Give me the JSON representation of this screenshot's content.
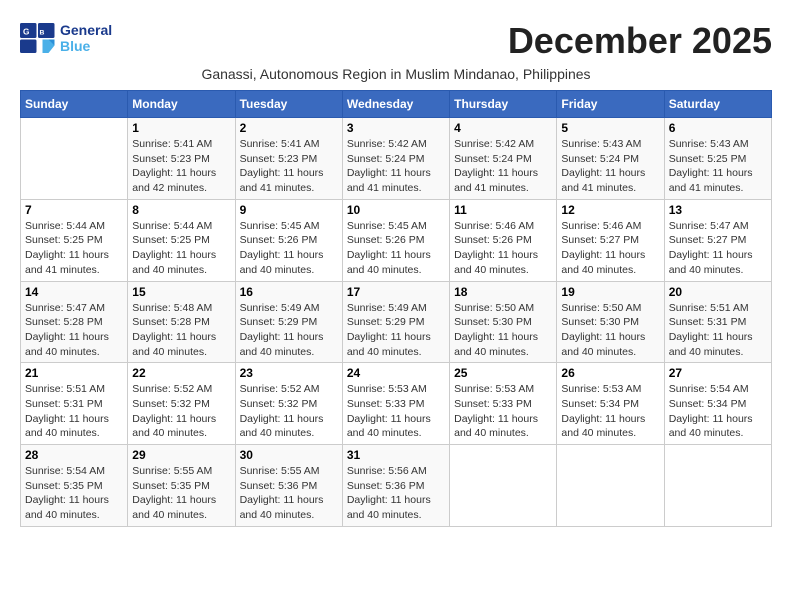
{
  "header": {
    "logo_line1": "General",
    "logo_line2": "Blue",
    "month_title": "December 2025",
    "subtitle": "Ganassi, Autonomous Region in Muslim Mindanao, Philippines"
  },
  "weekdays": [
    "Sunday",
    "Monday",
    "Tuesday",
    "Wednesday",
    "Thursday",
    "Friday",
    "Saturday"
  ],
  "weeks": [
    [
      {
        "day": "",
        "detail": ""
      },
      {
        "day": "1",
        "detail": "Sunrise: 5:41 AM\nSunset: 5:23 PM\nDaylight: 11 hours\nand 42 minutes."
      },
      {
        "day": "2",
        "detail": "Sunrise: 5:41 AM\nSunset: 5:23 PM\nDaylight: 11 hours\nand 41 minutes."
      },
      {
        "day": "3",
        "detail": "Sunrise: 5:42 AM\nSunset: 5:24 PM\nDaylight: 11 hours\nand 41 minutes."
      },
      {
        "day": "4",
        "detail": "Sunrise: 5:42 AM\nSunset: 5:24 PM\nDaylight: 11 hours\nand 41 minutes."
      },
      {
        "day": "5",
        "detail": "Sunrise: 5:43 AM\nSunset: 5:24 PM\nDaylight: 11 hours\nand 41 minutes."
      },
      {
        "day": "6",
        "detail": "Sunrise: 5:43 AM\nSunset: 5:25 PM\nDaylight: 11 hours\nand 41 minutes."
      }
    ],
    [
      {
        "day": "7",
        "detail": "Sunrise: 5:44 AM\nSunset: 5:25 PM\nDaylight: 11 hours\nand 41 minutes."
      },
      {
        "day": "8",
        "detail": "Sunrise: 5:44 AM\nSunset: 5:25 PM\nDaylight: 11 hours\nand 40 minutes."
      },
      {
        "day": "9",
        "detail": "Sunrise: 5:45 AM\nSunset: 5:26 PM\nDaylight: 11 hours\nand 40 minutes."
      },
      {
        "day": "10",
        "detail": "Sunrise: 5:45 AM\nSunset: 5:26 PM\nDaylight: 11 hours\nand 40 minutes."
      },
      {
        "day": "11",
        "detail": "Sunrise: 5:46 AM\nSunset: 5:26 PM\nDaylight: 11 hours\nand 40 minutes."
      },
      {
        "day": "12",
        "detail": "Sunrise: 5:46 AM\nSunset: 5:27 PM\nDaylight: 11 hours\nand 40 minutes."
      },
      {
        "day": "13",
        "detail": "Sunrise: 5:47 AM\nSunset: 5:27 PM\nDaylight: 11 hours\nand 40 minutes."
      }
    ],
    [
      {
        "day": "14",
        "detail": "Sunrise: 5:47 AM\nSunset: 5:28 PM\nDaylight: 11 hours\nand 40 minutes."
      },
      {
        "day": "15",
        "detail": "Sunrise: 5:48 AM\nSunset: 5:28 PM\nDaylight: 11 hours\nand 40 minutes."
      },
      {
        "day": "16",
        "detail": "Sunrise: 5:49 AM\nSunset: 5:29 PM\nDaylight: 11 hours\nand 40 minutes."
      },
      {
        "day": "17",
        "detail": "Sunrise: 5:49 AM\nSunset: 5:29 PM\nDaylight: 11 hours\nand 40 minutes."
      },
      {
        "day": "18",
        "detail": "Sunrise: 5:50 AM\nSunset: 5:30 PM\nDaylight: 11 hours\nand 40 minutes."
      },
      {
        "day": "19",
        "detail": "Sunrise: 5:50 AM\nSunset: 5:30 PM\nDaylight: 11 hours\nand 40 minutes."
      },
      {
        "day": "20",
        "detail": "Sunrise: 5:51 AM\nSunset: 5:31 PM\nDaylight: 11 hours\nand 40 minutes."
      }
    ],
    [
      {
        "day": "21",
        "detail": "Sunrise: 5:51 AM\nSunset: 5:31 PM\nDaylight: 11 hours\nand 40 minutes."
      },
      {
        "day": "22",
        "detail": "Sunrise: 5:52 AM\nSunset: 5:32 PM\nDaylight: 11 hours\nand 40 minutes."
      },
      {
        "day": "23",
        "detail": "Sunrise: 5:52 AM\nSunset: 5:32 PM\nDaylight: 11 hours\nand 40 minutes."
      },
      {
        "day": "24",
        "detail": "Sunrise: 5:53 AM\nSunset: 5:33 PM\nDaylight: 11 hours\nand 40 minutes."
      },
      {
        "day": "25",
        "detail": "Sunrise: 5:53 AM\nSunset: 5:33 PM\nDaylight: 11 hours\nand 40 minutes."
      },
      {
        "day": "26",
        "detail": "Sunrise: 5:53 AM\nSunset: 5:34 PM\nDaylight: 11 hours\nand 40 minutes."
      },
      {
        "day": "27",
        "detail": "Sunrise: 5:54 AM\nSunset: 5:34 PM\nDaylight: 11 hours\nand 40 minutes."
      }
    ],
    [
      {
        "day": "28",
        "detail": "Sunrise: 5:54 AM\nSunset: 5:35 PM\nDaylight: 11 hours\nand 40 minutes."
      },
      {
        "day": "29",
        "detail": "Sunrise: 5:55 AM\nSunset: 5:35 PM\nDaylight: 11 hours\nand 40 minutes."
      },
      {
        "day": "30",
        "detail": "Sunrise: 5:55 AM\nSunset: 5:36 PM\nDaylight: 11 hours\nand 40 minutes."
      },
      {
        "day": "31",
        "detail": "Sunrise: 5:56 AM\nSunset: 5:36 PM\nDaylight: 11 hours\nand 40 minutes."
      },
      {
        "day": "",
        "detail": ""
      },
      {
        "day": "",
        "detail": ""
      },
      {
        "day": "",
        "detail": ""
      }
    ]
  ]
}
